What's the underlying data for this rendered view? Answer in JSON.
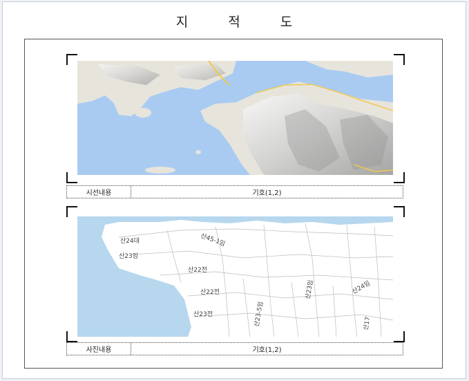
{
  "document": {
    "title": "지  적  도"
  },
  "panels": [
    {
      "kind": "terrain-map",
      "caption_label": "시선내용",
      "caption_value": "기호(1,2)"
    },
    {
      "kind": "cadastral-map",
      "caption_label": "사진내용",
      "caption_value": "기호(1,2)",
      "parcel_labels": [
        "산24대",
        "산23임",
        "산45-1임",
        "산22전",
        "산23전",
        "산22전",
        "산23-5임",
        "산23임",
        "산24임",
        "산17"
      ]
    }
  ],
  "colors": {
    "sea": "#a5c8f0",
    "land": "#e8e6df",
    "road": "#f2d67a",
    "cadastral_sea": "#b6d7ee"
  }
}
